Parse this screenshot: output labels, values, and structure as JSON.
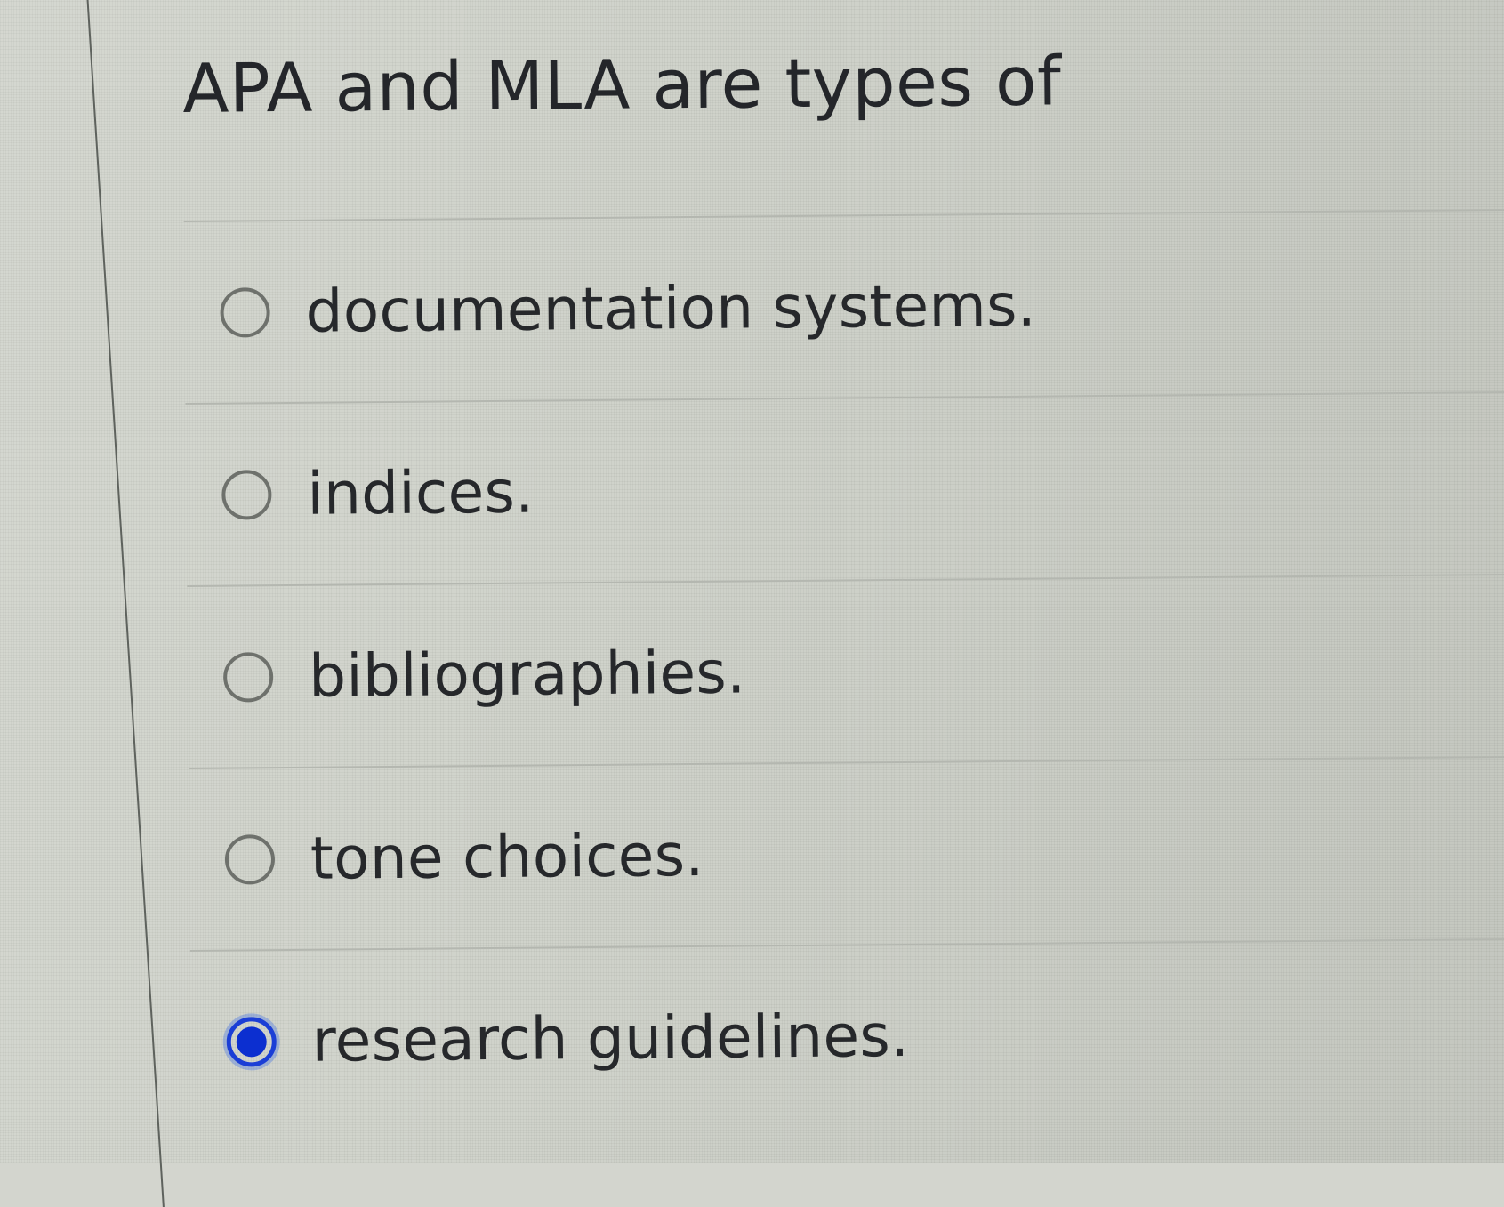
{
  "question": {
    "text": "APA and MLA are types of"
  },
  "options": [
    {
      "label": "documentation systems.",
      "selected": false
    },
    {
      "label": "indices.",
      "selected": false
    },
    {
      "label": "bibliographies.",
      "selected": false
    },
    {
      "label": "tone choices.",
      "selected": false
    },
    {
      "label": "research guidelines.",
      "selected": true
    }
  ],
  "colors": {
    "background": "#d0d3cb",
    "text": "#26282b",
    "radio_border": "#6e716c",
    "radio_selected": "#0c2fd0",
    "divider": "#b4b7b0"
  }
}
